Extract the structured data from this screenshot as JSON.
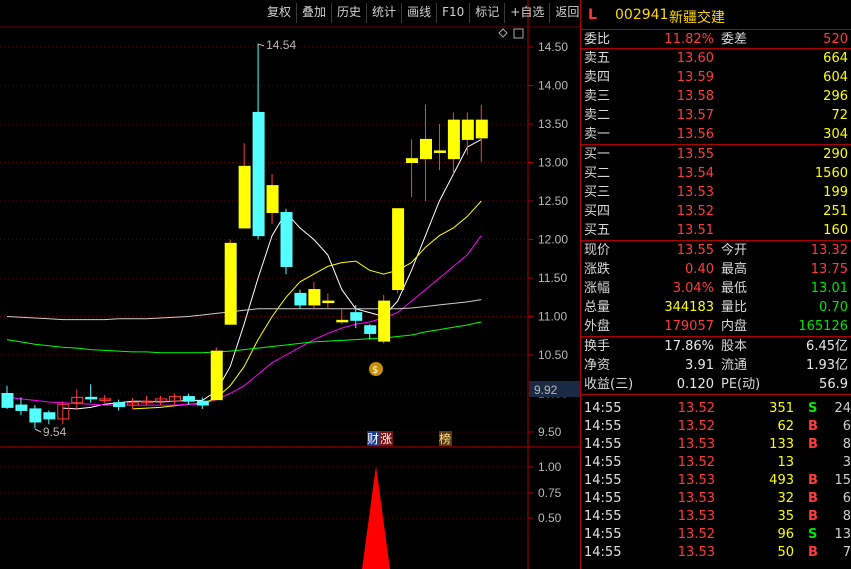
{
  "toolbar": {
    "items": [
      "复权",
      "叠加",
      "历史",
      "统计",
      "画线",
      "F10",
      "标记",
      "+自选",
      "返回"
    ]
  },
  "chart": {
    "y_labels": [
      "14.50",
      "14.00",
      "13.50",
      "13.00",
      "12.50",
      "12.00",
      "11.50",
      "11.00",
      "10.50",
      "10.00",
      "9.50"
    ],
    "high_marker": "14.54",
    "low_marker": "9.54",
    "current_price_tag": "9.92",
    "event_tags": [
      "财",
      "涨",
      "榜"
    ],
    "indicator_labels": [
      "1.00",
      "0.75",
      "0.50"
    ],
    "colors": {
      "up": "#ffff00",
      "down": "#54ffff",
      "ma5": "#ffffff",
      "ma10": "#ffff00",
      "ma20": "#ff00ff",
      "ma60": "#00ff00",
      "ma_extra": "#cccccc"
    }
  },
  "chart_data": {
    "type": "candlestick",
    "candles": [
      {
        "o": 10.0,
        "c": 9.82,
        "h": 10.1,
        "l": 9.8
      },
      {
        "o": 9.85,
        "c": 9.78,
        "h": 9.95,
        "l": 9.72
      },
      {
        "o": 9.8,
        "c": 9.63,
        "h": 9.85,
        "l": 9.55
      },
      {
        "o": 9.75,
        "c": 9.67,
        "h": 9.78,
        "l": 9.6
      },
      {
        "o": 9.67,
        "c": 9.86,
        "h": 9.9,
        "l": 9.6
      },
      {
        "o": 9.88,
        "c": 9.95,
        "h": 10.05,
        "l": 9.8
      },
      {
        "o": 9.95,
        "c": 9.93,
        "h": 10.12,
        "l": 9.88
      },
      {
        "o": 9.93,
        "c": 9.93,
        "h": 9.98,
        "l": 9.88
      },
      {
        "o": 9.88,
        "c": 9.83,
        "h": 9.92,
        "l": 9.78
      },
      {
        "o": 9.85,
        "c": 9.88,
        "h": 9.94,
        "l": 9.8
      },
      {
        "o": 9.9,
        "c": 9.9,
        "h": 9.97,
        "l": 9.85
      },
      {
        "o": 9.9,
        "c": 9.93,
        "h": 9.97,
        "l": 9.85
      },
      {
        "o": 9.9,
        "c": 9.96,
        "h": 10.0,
        "l": 9.85
      },
      {
        "o": 9.96,
        "c": 9.9,
        "h": 10.0,
        "l": 9.85
      },
      {
        "o": 9.9,
        "c": 9.85,
        "h": 9.95,
        "l": 9.8
      },
      {
        "o": 9.92,
        "c": 10.55,
        "h": 10.6,
        "l": 9.92
      },
      {
        "o": 10.9,
        "c": 11.95,
        "h": 12.0,
        "l": 10.9
      },
      {
        "o": 12.15,
        "c": 12.95,
        "h": 13.25,
        "l": 12.15
      },
      {
        "o": 13.65,
        "c": 12.05,
        "h": 14.54,
        "l": 12.0
      },
      {
        "o": 12.35,
        "c": 12.7,
        "h": 12.85,
        "l": 12.2
      },
      {
        "o": 12.35,
        "c": 11.65,
        "h": 12.4,
        "l": 11.55
      },
      {
        "o": 11.3,
        "c": 11.15,
        "h": 11.35,
        "l": 11.1
      },
      {
        "o": 11.15,
        "c": 11.35,
        "h": 11.45,
        "l": 11.1
      },
      {
        "o": 11.2,
        "c": 11.2,
        "h": 11.3,
        "l": 11.1
      },
      {
        "o": 10.95,
        "c": 10.95,
        "h": 11.1,
        "l": 10.9
      },
      {
        "o": 11.05,
        "c": 10.95,
        "h": 11.15,
        "l": 10.85
      },
      {
        "o": 10.88,
        "c": 10.78,
        "h": 10.9,
        "l": 10.7
      },
      {
        "o": 10.68,
        "c": 11.2,
        "h": 11.28,
        "l": 10.65
      },
      {
        "o": 11.35,
        "c": 12.4,
        "h": 12.4,
        "l": 11.3
      },
      {
        "o": 13.0,
        "c": 13.05,
        "h": 13.3,
        "l": 12.55
      },
      {
        "o": 13.05,
        "c": 13.3,
        "h": 13.75,
        "l": 12.5
      },
      {
        "o": 13.15,
        "c": 13.15,
        "h": 13.5,
        "l": 12.9
      },
      {
        "o": 13.05,
        "c": 13.55,
        "h": 13.65,
        "l": 12.85
      },
      {
        "o": 13.3,
        "c": 13.55,
        "h": 13.65,
        "l": 13.1
      },
      {
        "o": 13.32,
        "c": 13.55,
        "h": 13.75,
        "l": 13.01
      }
    ],
    "ma_series": [
      {
        "values": [
          null,
          null,
          null,
          null,
          9.81,
          9.8,
          9.82,
          9.86,
          9.88,
          9.9,
          9.9,
          9.89,
          9.9,
          9.91,
          9.91,
          10.03,
          10.35,
          10.9,
          11.5,
          12.05,
          12.35,
          12.15,
          12.0,
          11.8,
          11.35,
          11.1,
          11.05,
          11.0,
          11.2,
          11.6,
          12.05,
          12.5,
          12.85,
          13.2,
          13.3
        ]
      },
      {
        "values": [
          null,
          null,
          null,
          null,
          null,
          null,
          null,
          null,
          null,
          9.8,
          9.81,
          9.82,
          9.84,
          9.86,
          9.87,
          9.94,
          10.1,
          10.35,
          10.7,
          11.0,
          11.25,
          11.45,
          11.55,
          11.65,
          11.7,
          11.72,
          11.6,
          11.55,
          11.6,
          11.7,
          11.9,
          12.05,
          12.15,
          12.3,
          12.5
        ]
      },
      {
        "values": [
          9.95,
          9.93,
          9.91,
          9.89,
          9.88,
          9.87,
          9.86,
          9.85,
          9.85,
          9.85,
          9.85,
          9.85,
          9.85,
          9.86,
          9.86,
          9.92,
          10.0,
          10.1,
          10.25,
          10.4,
          10.5,
          10.6,
          10.7,
          10.78,
          10.85,
          10.9,
          10.93,
          10.98,
          11.05,
          11.2,
          11.35,
          11.5,
          11.65,
          11.8,
          12.05
        ]
      },
      {
        "values": [
          11.0,
          10.99,
          10.98,
          10.97,
          10.96,
          10.96,
          10.96,
          10.96,
          10.97,
          10.97,
          10.97,
          10.98,
          10.99,
          11.0,
          11.02,
          11.04,
          11.06,
          11.08,
          11.1,
          11.1,
          11.1,
          11.1,
          11.1,
          11.1,
          11.1,
          11.1,
          11.1,
          11.1,
          11.1,
          11.11,
          11.13,
          11.15,
          11.17,
          11.19,
          11.22
        ]
      },
      {
        "values": [
          10.7,
          10.67,
          10.64,
          10.62,
          10.6,
          10.59,
          10.57,
          10.56,
          10.55,
          10.54,
          10.54,
          10.53,
          10.53,
          10.53,
          10.53,
          10.54,
          10.55,
          10.57,
          10.59,
          10.61,
          10.63,
          10.65,
          10.67,
          10.68,
          10.69,
          10.7,
          10.71,
          10.72,
          10.74,
          10.76,
          10.8,
          10.83,
          10.86,
          10.89,
          10.93
        ]
      }
    ]
  },
  "quote": {
    "header": {
      "market": "L",
      "code": "002941",
      "name": "新疆交建"
    },
    "ratio": {
      "label1": "委比",
      "value1": "11.82%",
      "label2": "委差",
      "value2": "520"
    },
    "asks": [
      {
        "label": "卖五",
        "price": "13.60",
        "vol": "664"
      },
      {
        "label": "卖四",
        "price": "13.59",
        "vol": "604"
      },
      {
        "label": "卖三",
        "price": "13.58",
        "vol": "296"
      },
      {
        "label": "卖二",
        "price": "13.57",
        "vol": "72"
      },
      {
        "label": "卖一",
        "price": "13.56",
        "vol": "304"
      }
    ],
    "bids": [
      {
        "label": "买一",
        "price": "13.55",
        "vol": "290"
      },
      {
        "label": "买二",
        "price": "13.54",
        "vol": "1560"
      },
      {
        "label": "买三",
        "price": "13.53",
        "vol": "199"
      },
      {
        "label": "买四",
        "price": "13.52",
        "vol": "251"
      },
      {
        "label": "买五",
        "price": "13.51",
        "vol": "160"
      }
    ],
    "stats": [
      {
        "l1": "现价",
        "v1": "13.55",
        "c1": "red",
        "l2": "今开",
        "v2": "13.32",
        "c2": "red"
      },
      {
        "l1": "涨跌",
        "v1": "0.40",
        "c1": "red",
        "l2": "最高",
        "v2": "13.75",
        "c2": "red"
      },
      {
        "l1": "涨幅",
        "v1": "3.04%",
        "c1": "red",
        "l2": "最低",
        "v2": "13.01",
        "c2": "green"
      },
      {
        "l1": "总量",
        "v1": "344183",
        "c1": "yellow",
        "l2": "量比",
        "v2": "0.70",
        "c2": "green"
      },
      {
        "l1": "外盘",
        "v1": "179057",
        "c1": "red",
        "l2": "内盘",
        "v2": "165126",
        "c2": "green"
      }
    ],
    "fin": [
      {
        "l1": "换手",
        "v1": "17.86%",
        "l2": "股本",
        "v2": "6.45亿"
      },
      {
        "l1": "净资",
        "v1": "3.91",
        "l2": "流通",
        "v2": "1.93亿"
      },
      {
        "l1": "收益(三)",
        "v1": "0.120",
        "l2": "PE(动)",
        "v2": "56.9"
      }
    ],
    "ticks": [
      {
        "time": "14:55",
        "price": "13.52",
        "vol": "351",
        "bs": "S",
        "n": "24"
      },
      {
        "time": "14:55",
        "price": "13.52",
        "vol": "62",
        "bs": "B",
        "n": "6"
      },
      {
        "time": "14:55",
        "price": "13.53",
        "vol": "133",
        "bs": "B",
        "n": "8"
      },
      {
        "time": "14:55",
        "price": "13.52",
        "vol": "13",
        "bs": "",
        "n": "3"
      },
      {
        "time": "14:55",
        "price": "13.53",
        "vol": "493",
        "bs": "B",
        "n": "15"
      },
      {
        "time": "14:55",
        "price": "13.53",
        "vol": "32",
        "bs": "B",
        "n": "6"
      },
      {
        "time": "14:55",
        "price": "13.53",
        "vol": "35",
        "bs": "B",
        "n": "8"
      },
      {
        "time": "14:55",
        "price": "13.52",
        "vol": "96",
        "bs": "S",
        "n": "13"
      },
      {
        "time": "14:55",
        "price": "13.53",
        "vol": "50",
        "bs": "B",
        "n": "7"
      }
    ]
  }
}
